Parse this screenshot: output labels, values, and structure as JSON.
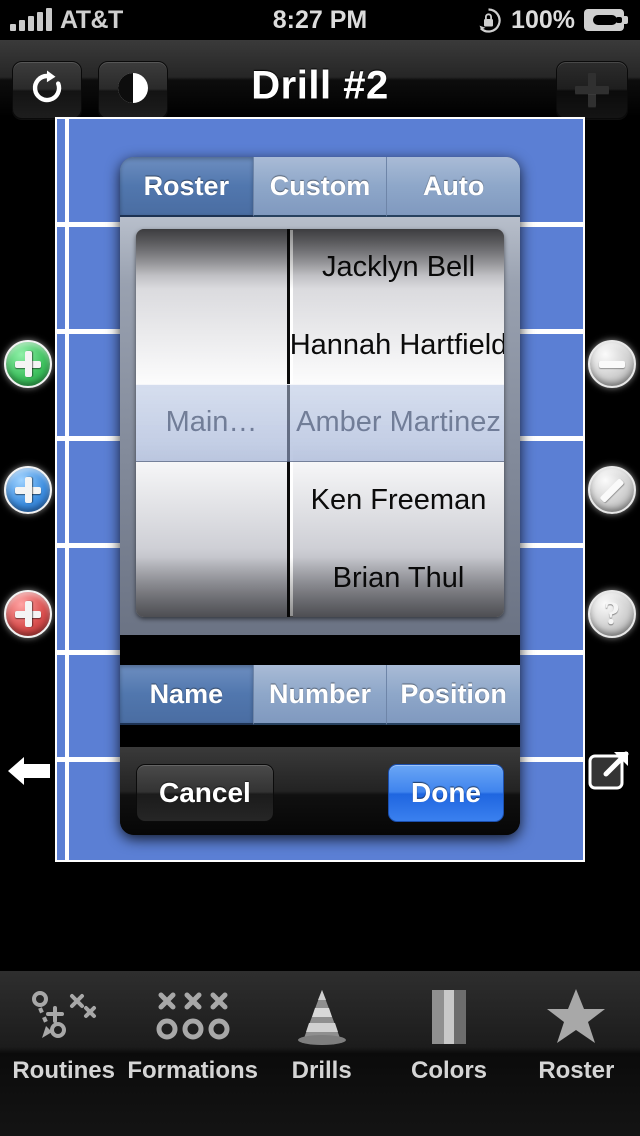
{
  "status_bar": {
    "carrier": "AT&T",
    "signal_bars": 5,
    "time": "8:27 PM",
    "battery_percent": "100%",
    "rotation_lock_icon": "rotation-lock-icon",
    "battery_icon": "battery-charging-icon"
  },
  "nav_bar": {
    "title": "Drill #2",
    "redo_icon": "redo-icon",
    "contrast_icon": "contrast-icon",
    "add_icon": "plus-icon"
  },
  "field": {
    "background_color": "#5b7fd4",
    "line_color": "#ffffff",
    "yard_line_count": 6
  },
  "left_controls": [
    {
      "name": "add-green-marker",
      "icon": "plus-circle-icon",
      "color": "#3fc15f"
    },
    {
      "name": "add-blue-marker",
      "icon": "plus-circle-icon",
      "color": "#3f8fe0"
    },
    {
      "name": "add-red-marker",
      "icon": "plus-circle-icon",
      "color": "#d9504f"
    }
  ],
  "right_controls": [
    {
      "name": "remove-marker",
      "icon": "minus-circle-icon",
      "color": "#cfcfcf"
    },
    {
      "name": "line-tool",
      "icon": "slash-circle-icon",
      "color": "#cfcfcf"
    },
    {
      "name": "help",
      "icon": "question-circle-icon",
      "color": "#cfcfcf"
    }
  ],
  "back_arrow_icon": "arrow-left-icon",
  "share_icon": "export-icon",
  "modal": {
    "source_tabs": [
      {
        "label": "Roster",
        "selected": true
      },
      {
        "label": "Custom",
        "selected": false
      },
      {
        "label": "Auto",
        "selected": false
      }
    ],
    "picker": {
      "left_column": [
        "",
        "",
        "Main…",
        "",
        ""
      ],
      "right_column": [
        "Jacklyn Bell",
        "Hannah Hartfield",
        "Amber Martinez",
        "Ken Freeman",
        "Brian Thul"
      ],
      "selected_index": 2,
      "selected_left": "Main…",
      "selected_right": "Amber Martinez"
    },
    "sort_tabs": [
      {
        "label": "Name",
        "selected": true
      },
      {
        "label": "Number",
        "selected": false
      },
      {
        "label": "Position",
        "selected": false
      }
    ],
    "cancel_label": "Cancel",
    "done_label": "Done",
    "done_color": "#3f84ee"
  },
  "tab_bar": [
    {
      "label": "Routines",
      "icon": "play-diagram-icon"
    },
    {
      "label": "Formations",
      "icon": "xo-formation-icon"
    },
    {
      "label": "Drills",
      "icon": "cone-icon"
    },
    {
      "label": "Colors",
      "icon": "color-bars-icon"
    },
    {
      "label": "Roster",
      "icon": "star-icon"
    }
  ]
}
